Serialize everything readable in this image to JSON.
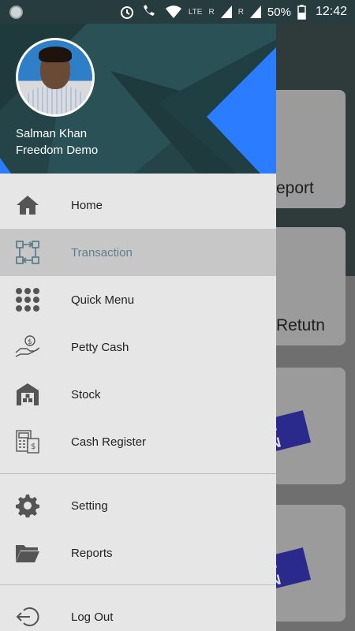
{
  "status_bar": {
    "network_label": "LTE",
    "network_label_2": "LTE",
    "roaming_1": "R",
    "roaming_2": "R",
    "battery_percent": "50%",
    "time": "12:42"
  },
  "background_app": {
    "card_1_label": "eport",
    "card_2_label": "Retutn",
    "tag_1": "NG ON",
    "tag_2": "NG ON"
  },
  "drawer": {
    "user_name": "Salman Khan",
    "company": "Freedom Demo",
    "menu_items": [
      {
        "label": "Home",
        "icon": "home-icon"
      },
      {
        "label": "Transaction",
        "icon": "transaction-icon",
        "active": true
      },
      {
        "label": "Quick Menu",
        "icon": "grid-dots-icon"
      },
      {
        "label": "Petty Cash",
        "icon": "cash-hand-icon"
      },
      {
        "label": "Stock",
        "icon": "warehouse-icon"
      },
      {
        "label": "Cash Register",
        "icon": "cash-register-icon"
      }
    ],
    "secondary_items": [
      {
        "label": "Setting",
        "icon": "gear-icon"
      },
      {
        "label": "Reports",
        "icon": "folder-icon"
      }
    ],
    "logout_label": "Log Out"
  },
  "colors": {
    "header_dark": "#244447",
    "accent_blue": "#2b7cff",
    "active_label": "#5f7f8c"
  }
}
